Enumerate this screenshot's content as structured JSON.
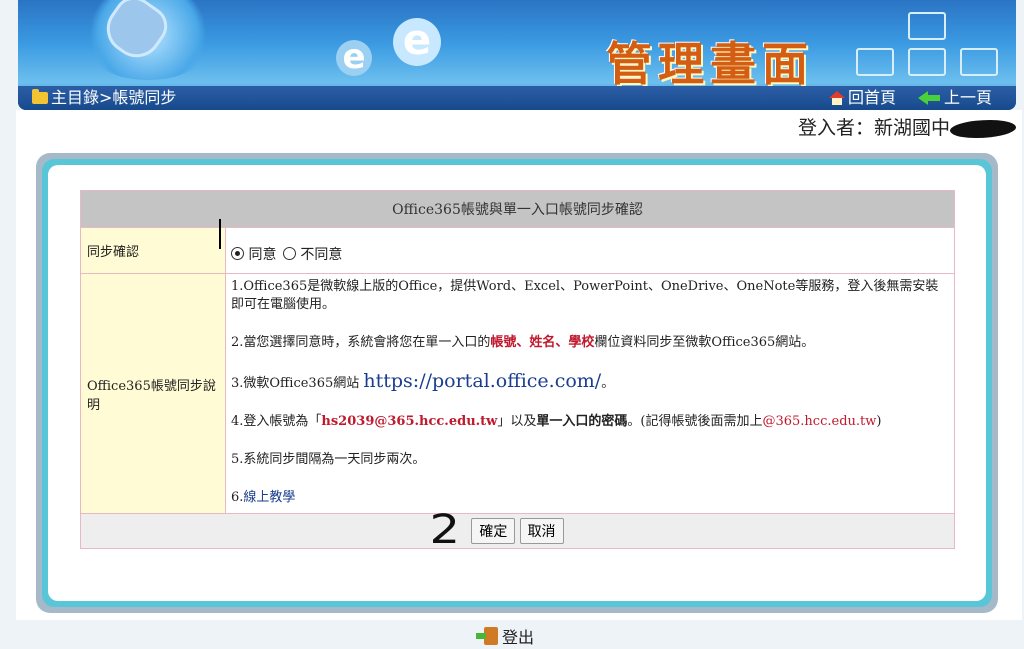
{
  "banner": {
    "title": "管理畫面"
  },
  "nav": {
    "breadcrumb": "主目錄>帳號同步",
    "home_label": "回首頁",
    "back_label": "上一頁"
  },
  "login": {
    "label": "登入者：新湖國中"
  },
  "form": {
    "header": "Office365帳號與單一入口帳號同步確認",
    "confirm_label": "同步確認",
    "options": {
      "agree": "同意",
      "disagree": "不同意",
      "selected": "同意"
    },
    "desc_label": "Office365帳號同步說明",
    "desc": {
      "p1": "1.Office365是微軟線上版的Office，提供Word、Excel、PowerPoint、OneDrive、OneNote等服務，登入後無需安裝即可在電腦使用。",
      "p2_pre": "2.當您選擇同意時，系統會將您在單一入口的",
      "p2_red": "帳號、姓名、學校",
      "p2_post": "欄位資料同步至微軟Office365網站。",
      "p3_pre": "3.微軟Office365網站 ",
      "p3_url": "https://portal.office.com/",
      "p3_post": "。",
      "p4_pre": "4.登入帳號為「",
      "p4_account": "hs2039@365.hcc.edu.tw",
      "p4_mid": "」以及",
      "p4_bold": "單一入口的密碼",
      "p4_note_pre": "。(記得帳號後面需加上",
      "p4_domain": "@365.hcc.edu.tw",
      "p4_note_post": ")",
      "p5": "5.系統同步間隔為一天同步兩次。",
      "p6_pre": "6.",
      "p6_link": "線上教學"
    },
    "ok_label": "確定",
    "cancel_label": "取消"
  },
  "annotations": {
    "mark2": "2"
  },
  "logout_label": "登出"
}
